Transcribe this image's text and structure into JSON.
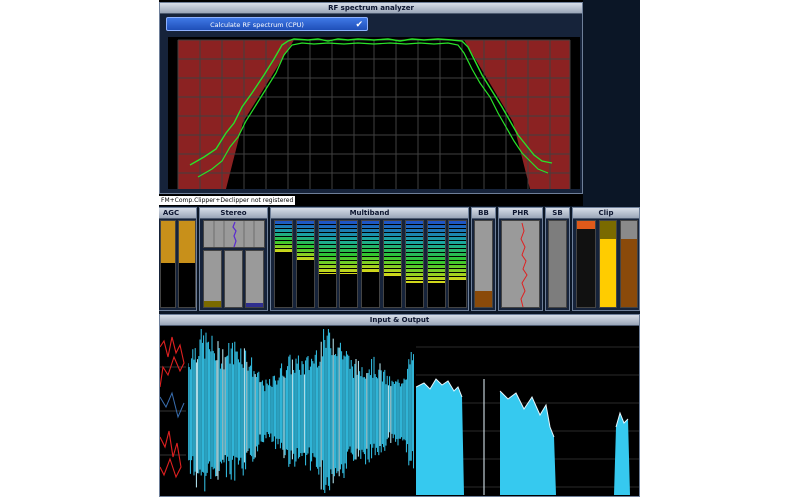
{
  "rf": {
    "title": "RF spectrum analyzer",
    "button_label": "Calculate RF spectrum (CPU)",
    "button_icon": "check-icon"
  },
  "status_text": "FM+Comp.Clipper+Declipper not registered",
  "meters": {
    "agc_label": "AGC",
    "stereo_label": "Stereo",
    "multiband_label": "Multiband",
    "bb_label": "BB",
    "phr_label": "PHR",
    "sb_label": "SB",
    "clip_label": "Clip"
  },
  "io": {
    "title": "Input & Output"
  },
  "colors": {
    "accent": "#2e63d8",
    "spectrum_mask": "#8b2222",
    "spectrum_trace": "#29e229",
    "waveform": "#36c9ef",
    "input_trace": "#e02020"
  }
}
